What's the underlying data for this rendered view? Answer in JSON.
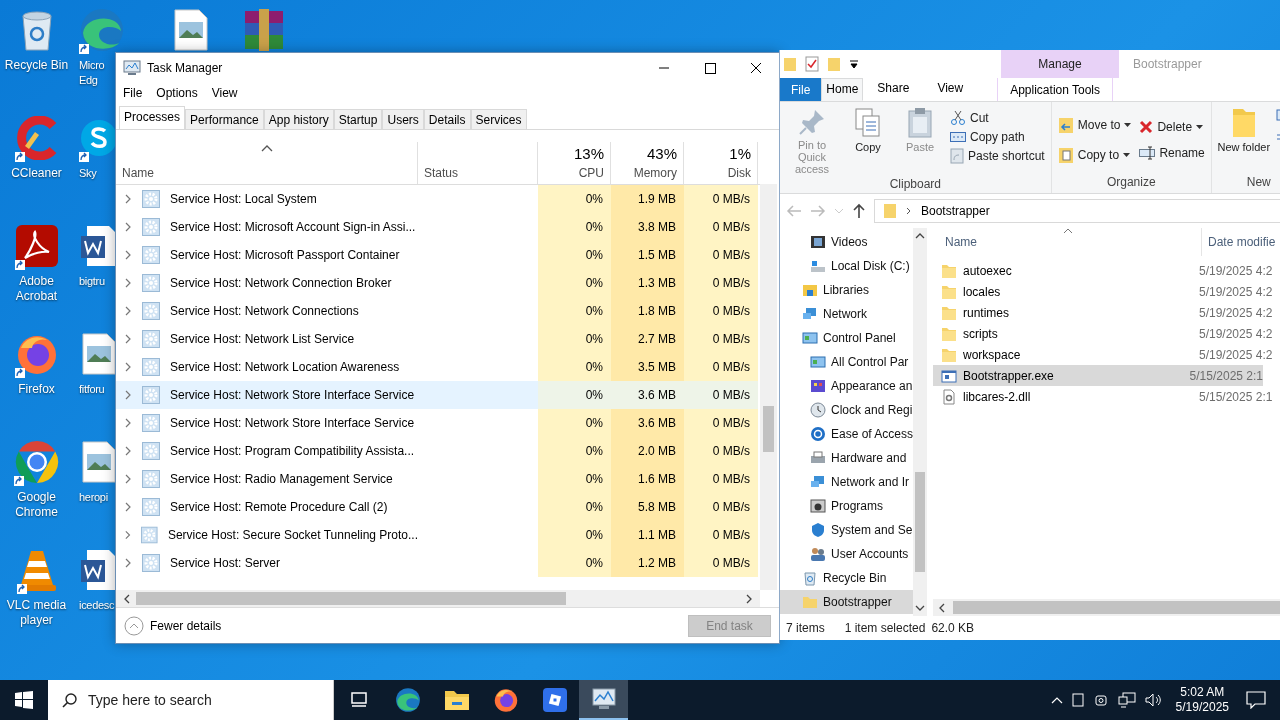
{
  "desktop": {
    "columns": [
      [
        {
          "label": "Recycle Bin",
          "kind": "recycle",
          "shortcut": false
        },
        {
          "label": "CCleaner",
          "kind": "ccleaner",
          "shortcut": true
        },
        {
          "label": "Adobe Acrobat",
          "kind": "acrobat",
          "shortcut": true
        },
        {
          "label": "Firefox",
          "kind": "firefox",
          "shortcut": true
        },
        {
          "label": "Google Chrome",
          "kind": "chrome",
          "shortcut": true
        },
        {
          "label": "VLC media player",
          "kind": "vlc",
          "shortcut": true
        }
      ],
      [
        {
          "label": "Micro Edg",
          "kind": "edge",
          "shortcut": true
        },
        {
          "label": "Sky",
          "kind": "skype",
          "shortcut": true
        },
        {
          "label": "bigtru",
          "kind": "word",
          "shortcut": false
        },
        {
          "label": "fitforu",
          "kind": "image",
          "shortcut": false
        },
        {
          "label": "heropi",
          "kind": "image",
          "shortcut": false
        },
        {
          "label": "icedesc",
          "kind": "word",
          "shortcut": false
        }
      ],
      [
        {
          "kind": "image",
          "shortcut": false
        }
      ],
      [
        {
          "kind": "winrar",
          "shortcut": false
        }
      ]
    ]
  },
  "task_manager": {
    "title": "Task Manager",
    "menu": [
      "File",
      "Options",
      "View"
    ],
    "tabs": [
      {
        "label": "Processes",
        "selected": true
      },
      {
        "label": "Performance",
        "selected": false
      },
      {
        "label": "App history",
        "selected": false
      },
      {
        "label": "Startup",
        "selected": false
      },
      {
        "label": "Users",
        "selected": false
      },
      {
        "label": "Details",
        "selected": false
      },
      {
        "label": "Services",
        "selected": false
      }
    ],
    "columns": [
      {
        "label": "Name",
        "sorted": true
      },
      {
        "label": "Status",
        "sorted": false
      },
      {
        "label": "CPU",
        "total": "13%",
        "sorted": false
      },
      {
        "label": "Memory",
        "total": "43%",
        "sorted": false
      },
      {
        "label": "Disk",
        "total": "1%",
        "sorted": false
      }
    ],
    "rows": [
      {
        "name": "Service Host: Local System",
        "cpu": "0%",
        "memory": "1.9 MB",
        "disk": "0 MB/s",
        "highlighted": false
      },
      {
        "name": "Service Host: Microsoft Account Sign-in Assi...",
        "cpu": "0%",
        "memory": "3.8 MB",
        "disk": "0 MB/s",
        "highlighted": false
      },
      {
        "name": "Service Host: Microsoft Passport Container",
        "cpu": "0%",
        "memory": "1.5 MB",
        "disk": "0 MB/s",
        "highlighted": false
      },
      {
        "name": "Service Host: Network Connection Broker",
        "cpu": "0%",
        "memory": "1.3 MB",
        "disk": "0 MB/s",
        "highlighted": false
      },
      {
        "name": "Service Host: Network Connections",
        "cpu": "0%",
        "memory": "1.8 MB",
        "disk": "0 MB/s",
        "highlighted": false
      },
      {
        "name": "Service Host: Network List Service",
        "cpu": "0%",
        "memory": "2.7 MB",
        "disk": "0 MB/s",
        "highlighted": false
      },
      {
        "name": "Service Host: Network Location Awareness",
        "cpu": "0%",
        "memory": "3.5 MB",
        "disk": "0 MB/s",
        "highlighted": false
      },
      {
        "name": "Service Host: Network Store Interface Service",
        "cpu": "0%",
        "memory": "3.6 MB",
        "disk": "0 MB/s",
        "highlighted": true
      },
      {
        "name": "Service Host: Network Store Interface Service",
        "cpu": "0%",
        "memory": "3.6 MB",
        "disk": "0 MB/s",
        "highlighted": false
      },
      {
        "name": "Service Host: Program Compatibility Assista...",
        "cpu": "0%",
        "memory": "2.0 MB",
        "disk": "0 MB/s",
        "highlighted": false
      },
      {
        "name": "Service Host: Radio Management Service",
        "cpu": "0%",
        "memory": "1.6 MB",
        "disk": "0 MB/s",
        "highlighted": false
      },
      {
        "name": "Service Host: Remote Procedure Call (2)",
        "cpu": "0%",
        "memory": "5.8 MB",
        "disk": "0 MB/s",
        "highlighted": false
      },
      {
        "name": "Service Host: Secure Socket Tunneling Proto...",
        "cpu": "0%",
        "memory": "1.1 MB",
        "disk": "0 MB/s",
        "highlighted": false
      },
      {
        "name": "Service Host: Server",
        "cpu": "0%",
        "memory": "1.2 MB",
        "disk": "0 MB/s",
        "highlighted": false
      }
    ],
    "footer": {
      "toggle": "Fewer details",
      "end_task": {
        "label": "End task",
        "disabled": true
      }
    }
  },
  "explorer": {
    "title": "Bootstrapper",
    "context_tab": "Manage",
    "ribbon_tabs": [
      {
        "label": "File",
        "kind": "file",
        "selected": false
      },
      {
        "label": "Home",
        "kind": "tab",
        "selected": true
      },
      {
        "label": "Share",
        "kind": "tab",
        "selected": false
      },
      {
        "label": "View",
        "kind": "tab",
        "selected": false
      },
      {
        "label": "Application Tools",
        "kind": "context",
        "selected": false
      }
    ],
    "clipboard": {
      "label": "Clipboard",
      "pin": "Pin to Quick access",
      "copy": "Copy",
      "paste": "Paste",
      "cut": "Cut",
      "copy_path": "Copy path",
      "paste_shortcut": "Paste shortcut"
    },
    "organize": {
      "label": "Organize",
      "move_to": "Move to",
      "copy_to": "Copy to",
      "delete": "Delete",
      "rename": "Rename"
    },
    "new": {
      "label": "New",
      "new_folder": "New folder"
    },
    "address": {
      "path": "Bootstrapper"
    },
    "nav_pane": {
      "items": [
        {
          "children": [
            {
              "label": "Videos",
              "kind": "video",
              "selected": false
            },
            {
              "label": "Local Disk (C:)",
              "kind": "disk",
              "selected": false
            }
          ]
        },
        {
          "label": "Libraries",
          "kind": "library",
          "selected": false
        },
        {
          "label": "Network",
          "kind": "network",
          "selected": false
        },
        {
          "label": "Control Panel",
          "kind": "control-panel",
          "selected": false,
          "children": [
            {
              "label": "All Control Par",
              "kind": "control-panel",
              "selected": false
            },
            {
              "label": "Appearance an",
              "kind": "appearance",
              "selected": false
            },
            {
              "label": "Clock and Regi",
              "kind": "clock",
              "selected": false
            },
            {
              "label": "Ease of Access",
              "kind": "ease",
              "selected": false
            },
            {
              "label": "Hardware and",
              "kind": "printer",
              "selected": false
            },
            {
              "label": "Network and Ir",
              "kind": "network",
              "selected": false
            },
            {
              "label": "Programs",
              "kind": "programs",
              "selected": false
            },
            {
              "label": "System and Se",
              "kind": "shield",
              "selected": false
            },
            {
              "label": "User Accounts",
              "kind": "users",
              "selected": false
            }
          ]
        },
        {
          "label": "Recycle Bin",
          "kind": "recycle",
          "selected": false
        },
        {
          "label": "Bootstrapper",
          "kind": "folder",
          "selected": true
        }
      ]
    },
    "columns": [
      {
        "label": "Name"
      },
      {
        "label": "Date modifie"
      }
    ],
    "files": [
      {
        "name": "autoexec",
        "kind": "folder",
        "date": "5/19/2025 4:2",
        "selected": false
      },
      {
        "name": "locales",
        "kind": "folder",
        "date": "5/19/2025 4:2",
        "selected": false
      },
      {
        "name": "runtimes",
        "kind": "folder",
        "date": "5/19/2025 4:2",
        "selected": false
      },
      {
        "name": "scripts",
        "kind": "folder",
        "date": "5/19/2025 4:2",
        "selected": false
      },
      {
        "name": "workspace",
        "kind": "folder",
        "date": "5/19/2025 4:2",
        "selected": false
      },
      {
        "name": "Bootstrapper.exe",
        "kind": "exe",
        "date": "5/15/2025 2:1",
        "selected": true
      },
      {
        "name": "libcares-2.dll",
        "kind": "dll",
        "date": "5/15/2025 2:1",
        "selected": false
      }
    ],
    "status": {
      "count": "7 items",
      "selection": "1 item selected",
      "size": "62.0 KB"
    }
  },
  "taskbar": {
    "search": {
      "placeholder": "Type here to search"
    },
    "apps": [
      {
        "kind": "task-view",
        "active": false
      },
      {
        "kind": "edge",
        "active": false
      },
      {
        "kind": "folder",
        "active": false
      },
      {
        "kind": "firefox",
        "active": false
      },
      {
        "kind": "app",
        "active": false
      },
      {
        "kind": "task-manager",
        "active": true
      }
    ],
    "time": "5:02 AM",
    "date": "5/19/2025"
  }
}
